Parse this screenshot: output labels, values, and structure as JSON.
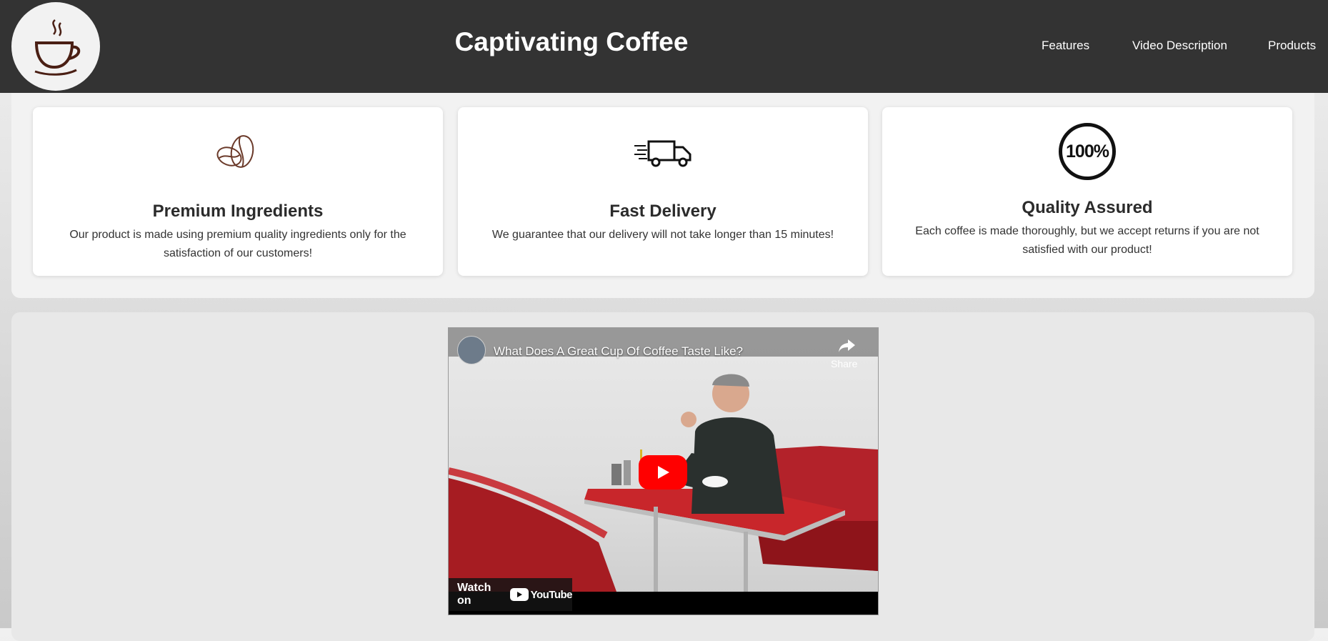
{
  "header": {
    "title": "Captivating Coffee",
    "nav": [
      "Features",
      "Video Description",
      "Products"
    ]
  },
  "features": [
    {
      "icon": "coffee-beans-icon",
      "title": "Premium Ingredients",
      "text": "Our product is made using premium quality ingredients only for the satisfaction of our customers!"
    },
    {
      "icon": "delivery-truck-icon",
      "title": "Fast Delivery",
      "text": "We guarantee that our delivery will not take longer than 15 minutes!"
    },
    {
      "icon": "hundred-percent-icon",
      "badge": "100%",
      "title": "Quality Assured",
      "text": "Each coffee is made thoroughly, but we accept returns if you are not satisfied with our product!"
    }
  ],
  "video": {
    "title": "What Does A Great Cup Of Coffee Taste Like?",
    "share_label": "Share",
    "watch_on_label": "Watch on",
    "youtube_label": "YouTube"
  },
  "colors": {
    "header_bg": "#333333",
    "youtube_red": "#ff0000",
    "logo_brown": "#4a1f14"
  }
}
